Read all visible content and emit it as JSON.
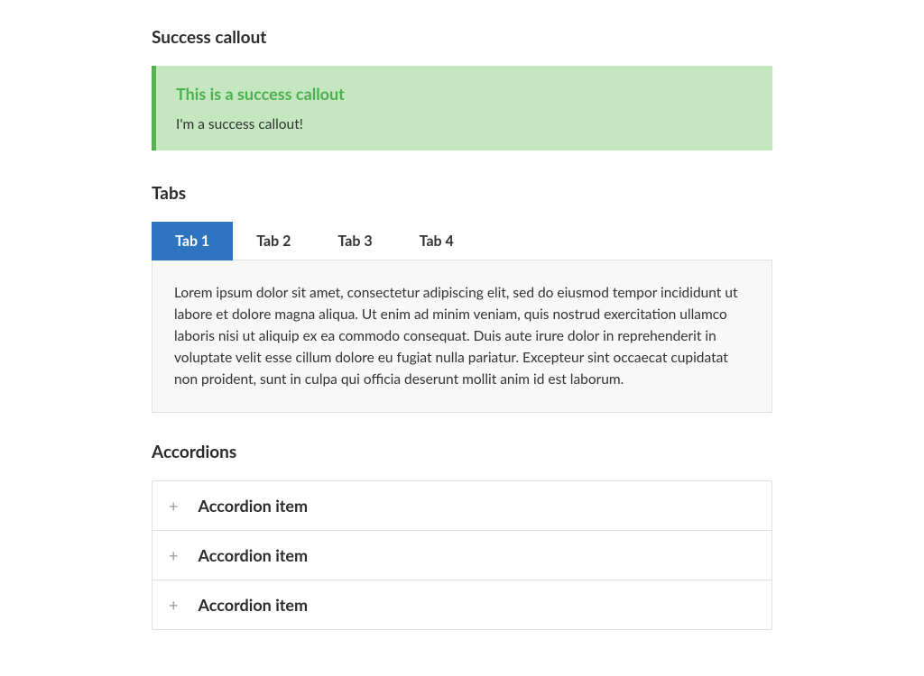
{
  "sections": {
    "callout_heading": "Success callout",
    "tabs_heading": "Tabs",
    "accordions_heading": "Accordions"
  },
  "callout": {
    "title": "This is a success callout",
    "body": "I'm a success callout!"
  },
  "tabs": {
    "items": [
      {
        "label": "Tab 1"
      },
      {
        "label": "Tab 2"
      },
      {
        "label": "Tab 3"
      },
      {
        "label": "Tab 4"
      }
    ],
    "active_index": 0,
    "panel_text": "Lorem ipsum dolor sit amet, consectetur adipiscing elit, sed do eiusmod tempor incididunt ut labore et dolore magna aliqua. Ut enim ad minim veniam, quis nostrud exercitation ullamco laboris nisi ut aliquip ex ea commodo consequat. Duis aute irure dolor in reprehenderit in voluptate velit esse cillum dolore eu fugiat nulla pariatur. Excepteur sint occaecat cupidatat non proident, sunt in culpa qui officia deserunt mollit anim id est laborum."
  },
  "accordions": {
    "items": [
      {
        "label": "Accordion item"
      },
      {
        "label": "Accordion item"
      },
      {
        "label": "Accordion item"
      }
    ]
  }
}
